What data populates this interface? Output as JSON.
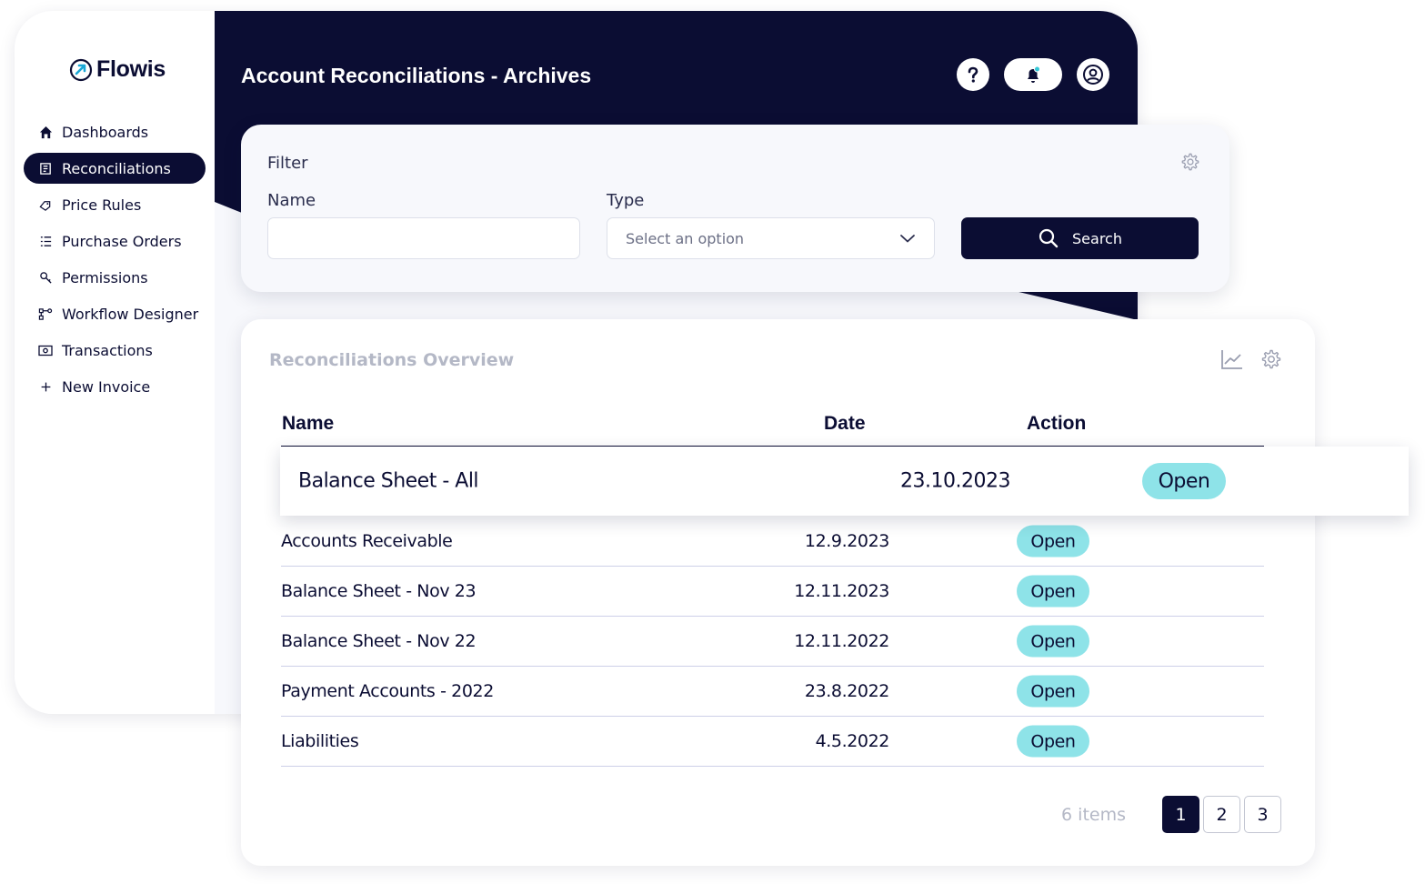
{
  "app": {
    "name": "Flowis",
    "page_title": "Account Reconciliations - Archives"
  },
  "sidebar": {
    "items": [
      {
        "label": "Dashboards",
        "icon": "home-icon",
        "active": false
      },
      {
        "label": "Reconciliations",
        "icon": "reconciliations-icon",
        "active": true
      },
      {
        "label": "Price Rules",
        "icon": "price-tag-icon",
        "active": false
      },
      {
        "label": "Purchase Orders",
        "icon": "list-icon",
        "active": false
      },
      {
        "label": "Permissions",
        "icon": "key-icon",
        "active": false
      },
      {
        "label": "Workflow Designer",
        "icon": "workflow-icon",
        "active": false
      },
      {
        "label": "Transactions",
        "icon": "money-icon",
        "active": false
      },
      {
        "label": "New Invoice",
        "icon": "plus-icon",
        "active": false
      }
    ]
  },
  "filter": {
    "title": "Filter",
    "name_label": "Name",
    "name_value": "",
    "type_label": "Type",
    "type_placeholder": "Select an option",
    "search_label": "Search"
  },
  "overview": {
    "title": "Reconciliations Overview",
    "columns": {
      "name": "Name",
      "date": "Date",
      "action": "Action"
    },
    "featured": {
      "name": "Balance Sheet - All",
      "date": "23.10.2023",
      "action": "Open"
    },
    "rows": [
      {
        "name": "Accounts Receivable",
        "date": "12.9.2023",
        "action": "Open"
      },
      {
        "name": "Balance Sheet - Nov 23",
        "date": "12.11.2023",
        "action": "Open"
      },
      {
        "name": "Balance Sheet - Nov 22",
        "date": "12.11.2022",
        "action": "Open"
      },
      {
        "name": "Payment Accounts - 2022",
        "date": "23.8.2022",
        "action": "Open"
      },
      {
        "name": "Liabilities",
        "date": "4.5.2022",
        "action": "Open"
      }
    ],
    "items_count": "6 items",
    "pages": [
      "1",
      "2",
      "3"
    ],
    "current_page": "1"
  },
  "colors": {
    "navy": "#0b0d33",
    "accent_cyan": "#8ee3e8",
    "background": "#f7f8fc"
  }
}
